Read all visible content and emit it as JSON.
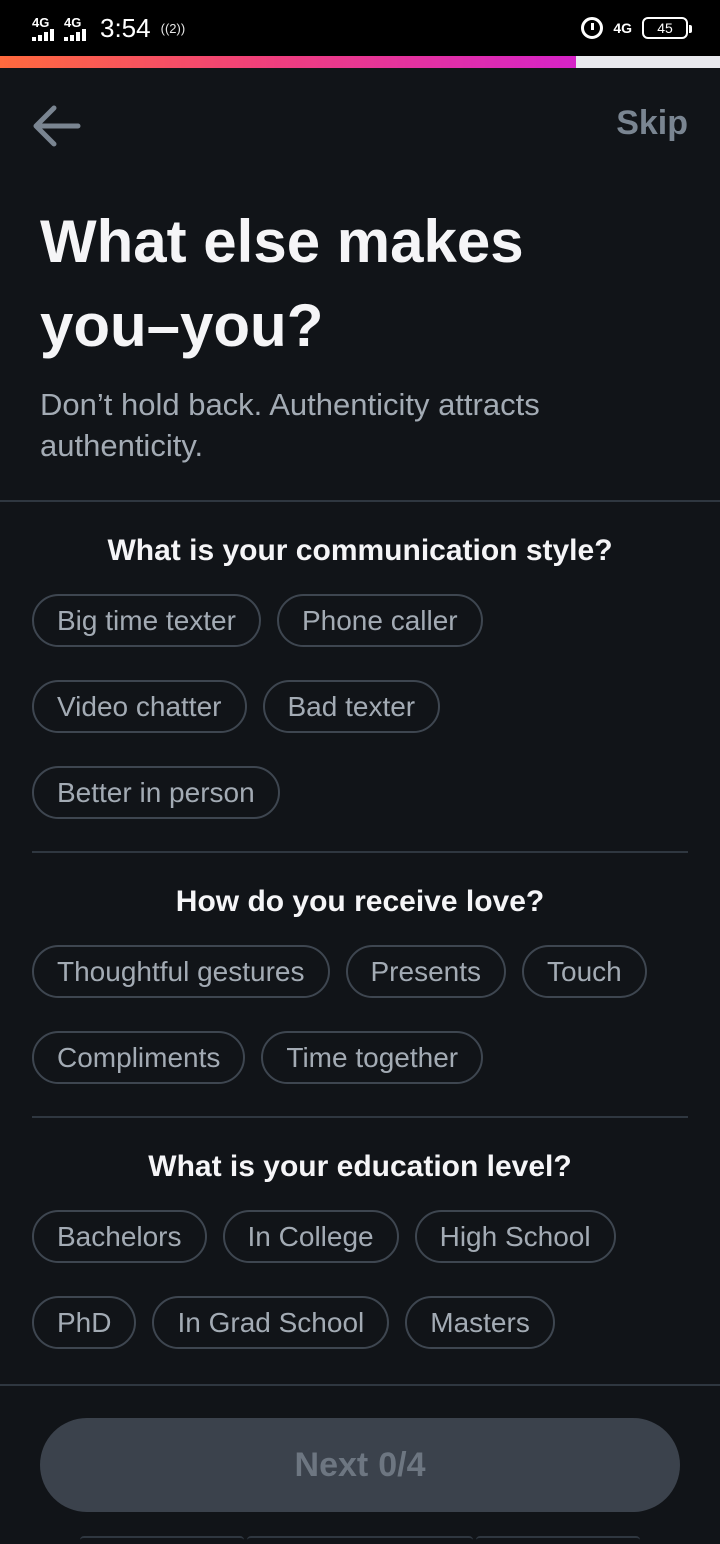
{
  "status_bar": {
    "network1": "4G",
    "network2": "4G",
    "time": "3:54",
    "hotspot": "((2))",
    "network_right": "4G",
    "battery": "45"
  },
  "progress": {
    "fraction": 0.8
  },
  "nav": {
    "skip_label": "Skip",
    "back_icon": "arrow-left-icon"
  },
  "header": {
    "title": "What else makes you–you?",
    "subtitle": "Don’t hold back. Authenticity attracts authenticity."
  },
  "sections": [
    {
      "title": "What is your communication style?",
      "options": [
        "Big time texter",
        "Phone caller",
        "Video chatter",
        "Bad texter",
        "Better in person"
      ]
    },
    {
      "title": "How do you receive love?",
      "options": [
        "Thoughtful gestures",
        "Presents",
        "Touch",
        "Compliments",
        "Time together"
      ]
    },
    {
      "title": "What is your education level?",
      "options": [
        "Bachelors",
        "In College",
        "High School",
        "PhD",
        "In Grad School",
        "Masters"
      ]
    }
  ],
  "footer": {
    "next_label": "Next",
    "next_count": "0/4"
  },
  "colors": {
    "background": "#111418",
    "chip_border": "#3e4650",
    "chip_text": "#a3abb4",
    "progress_start": "#ff6a3d",
    "progress_end": "#d623c8",
    "button_disabled": "#3b424c"
  }
}
